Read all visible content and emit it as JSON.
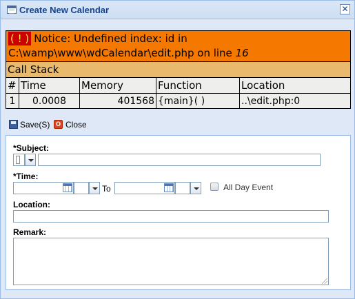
{
  "window": {
    "title": "Create New Calendar",
    "close_glyph": "✕",
    "icon": "calendar-icon"
  },
  "php_notice": {
    "badge": "( ! )",
    "message": "Notice: Undefined index: id in C:\\wamp\\www\\wdCalendar\\edit.php on line ",
    "line": "16",
    "call_stack_title": "Call Stack",
    "columns": [
      "#",
      "Time",
      "Memory",
      "Function",
      "Location"
    ],
    "rows": [
      {
        "num": "1",
        "time": "0.0008",
        "memory": "401568",
        "function": "{main}( )",
        "location": "..\\edit.php:0"
      }
    ],
    "colors": {
      "error_bg": "#f57900",
      "stack_bg": "#e9b96e",
      "cell_bg": "#eeeeec"
    }
  },
  "toolbar": {
    "save_label": "Save(S)",
    "close_label": "Close"
  },
  "form": {
    "subject_label": "*Subject:",
    "subject_value": "",
    "time_label": "*Time:",
    "start_date": "",
    "start_time": "",
    "to_label": "To",
    "end_date": "",
    "end_time": "",
    "all_day_label": "All Day Event",
    "all_day_checked": false,
    "location_label": "Location:",
    "location_value": "",
    "remark_label": "Remark:",
    "remark_value": ""
  }
}
